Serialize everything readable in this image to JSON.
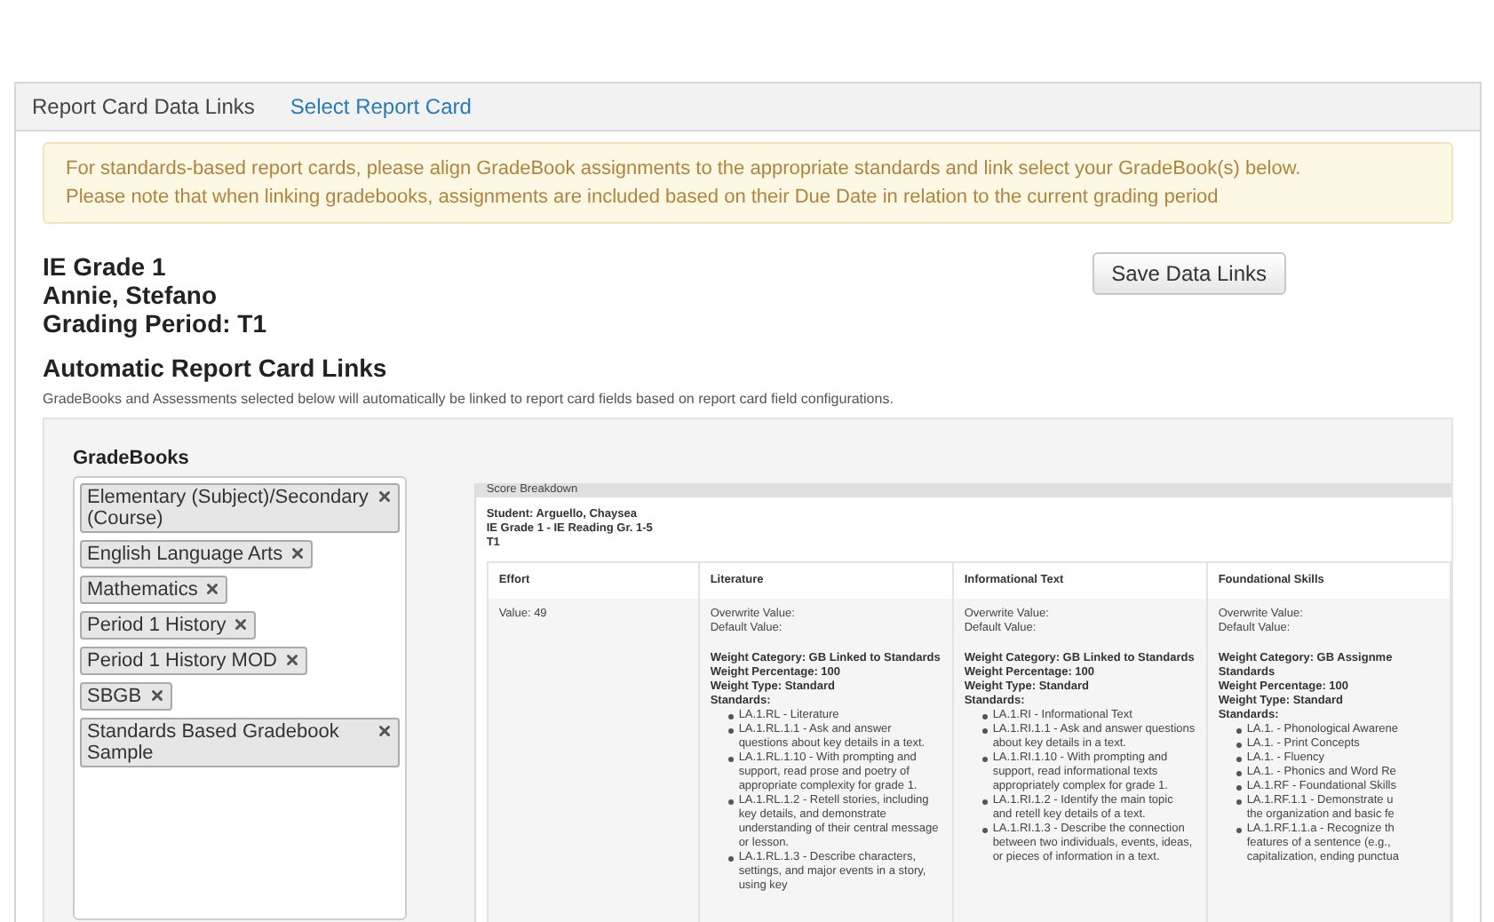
{
  "header": {
    "title": "Report Card Data Links",
    "link": "Select Report Card"
  },
  "alert": [
    "For standards-based report cards, please align GradeBook assignments to the appropriate standards and link select your GradeBook(s) below.",
    "Please note that when linking gradebooks, assignments are included based on their Due Date in relation to the current grading period"
  ],
  "info": [
    "IE Grade 1",
    "Annie, Stefano",
    "Grading Period: T1"
  ],
  "save_button": "Save Data Links",
  "section": {
    "title": "Automatic Report Card Links",
    "subtitle": "GradeBooks and Assessments selected below will automatically be linked to report card fields based on report card field configurations."
  },
  "gradebooks": {
    "label": "GradeBooks",
    "tags": [
      {
        "label": "Elementary (Subject)/Secondary (Course)"
      },
      {
        "label": "English Language Arts"
      },
      {
        "label": "Mathematics"
      },
      {
        "label": "Period 1 History"
      },
      {
        "label": "Period 1 History MOD"
      },
      {
        "label": "SBGB"
      },
      {
        "label": "Standards Based Gradebook Sample"
      }
    ]
  },
  "breakdown": {
    "title": "Score Breakdown",
    "student": [
      "Student: Arguello, Chaysea",
      "IE Grade 1 - IE Reading Gr. 1-5",
      "T1"
    ],
    "columns": [
      {
        "heading": "Effort",
        "kind": "value",
        "lines": [
          "Value: 49"
        ]
      },
      {
        "heading": "Literature",
        "kind": "standards",
        "lines": [
          "Overwrite Value:",
          "Default Value:"
        ],
        "weight": [
          "Weight Category: GB Linked to Standards",
          "Weight Percentage: 100",
          "Weight Type: Standard",
          "Standards:"
        ],
        "standards": [
          "LA.1.RL - Literature",
          "LA.1.RL.1.1 - Ask and answer questions about key details in a text.",
          "LA.1.RL.1.10 - With prompting and support, read prose and poetry of appropriate complexity for grade 1.",
          "LA.1.RL.1.2 - Retell stories, including key details, and demonstrate understanding of their central message or lesson.",
          "LA.1.RL.1.3 - Describe characters, settings, and major events in a story, using key"
        ]
      },
      {
        "heading": "Informational Text",
        "kind": "standards",
        "lines": [
          "Overwrite Value:",
          "Default Value:"
        ],
        "weight": [
          "Weight Category: GB Linked to Standards",
          "Weight Percentage: 100",
          "Weight Type: Standard",
          "Standards:"
        ],
        "standards": [
          "LA.1.RI - Informational Text",
          "LA.1.RI.1.1 - Ask and answer questions about key details in a text.",
          "LA.1.RI.1.10 - With prompting and support, read informational texts appropriately complex for grade 1.",
          "LA.1.RI.1.2 - Identify the main topic and retell key details of a text.",
          "LA.1.RI.1.3 - Describe the connection between two individuals, events, ideas, or pieces of information in a text."
        ]
      },
      {
        "heading": "Foundational Skills",
        "kind": "standards",
        "lines": [
          "Overwrite Value:",
          "Default Value:"
        ],
        "weight": [
          "Weight Category: GB Assignme\nStandards",
          "Weight Percentage: 100",
          "Weight Type: Standard",
          "Standards:"
        ],
        "standards": [
          "LA.1. - Phonological Awarene",
          "LA.1. - Print Concepts",
          "LA.1. - Fluency",
          "LA.1. - Phonics and Word Re",
          "LA.1.RF - Foundational Skills",
          "LA.1.RF.1.1 - Demonstrate u\nthe organization and basic fe",
          "LA.1.RF.1.1.a - Recognize th\nfeatures of a sentence (e.g.,\ncapitalization, ending punctua"
        ]
      }
    ]
  }
}
